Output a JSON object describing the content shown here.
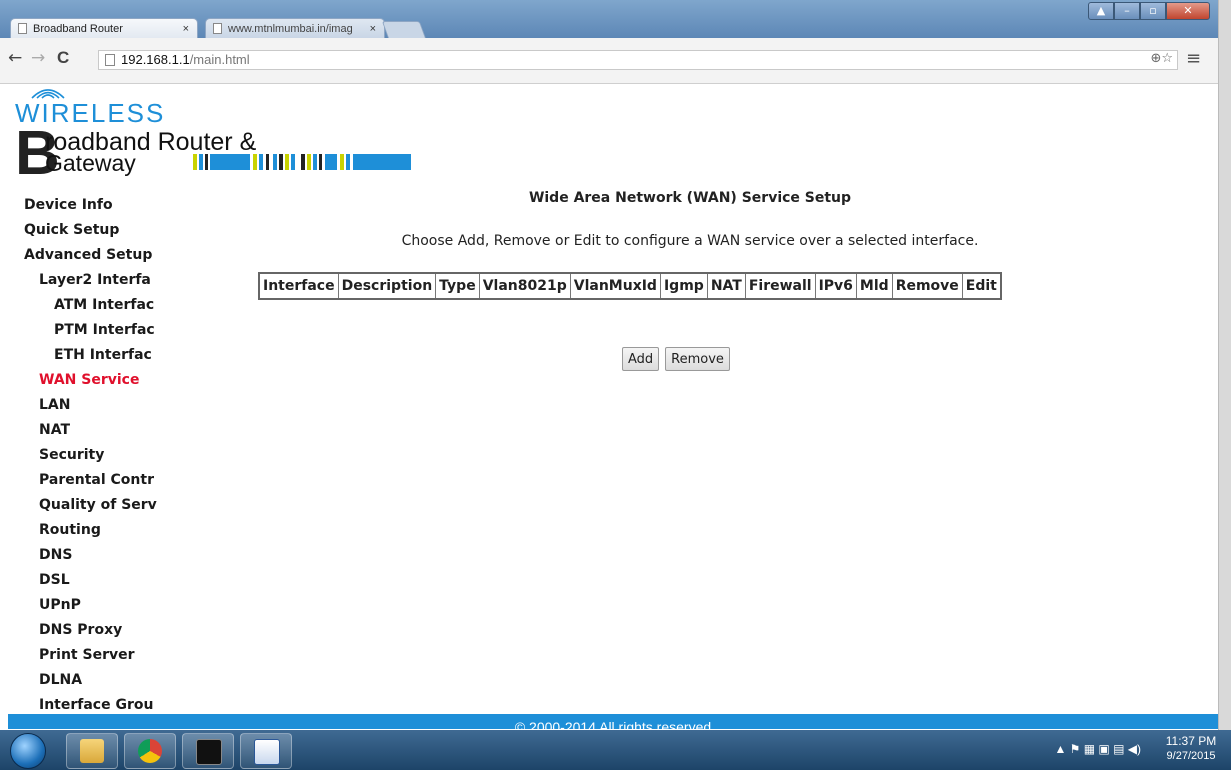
{
  "browser": {
    "tabs": [
      {
        "label": "Broadband Router",
        "close": "×"
      },
      {
        "label": "www.mtnlmumbai.in/imag",
        "close": "×"
      }
    ],
    "url_host": "192.168.1.1",
    "url_path": "/main.html",
    "back": "←",
    "forward": "→",
    "reload": "C",
    "url_right": "⊕☆",
    "menu": "≡"
  },
  "logo": {
    "wireless": "WIRELESS",
    "letter_b": "B",
    "line1": "roadband Router &",
    "line2": "Gateway"
  },
  "sidebar": {
    "items": [
      {
        "label": "Device Info",
        "level": 1
      },
      {
        "label": "Quick Setup",
        "level": 1
      },
      {
        "label": "Advanced Setup",
        "level": 1
      },
      {
        "label": "Layer2 Interfa",
        "level": 2
      },
      {
        "label": "ATM Interfac",
        "level": 3
      },
      {
        "label": "PTM Interfac",
        "level": 3
      },
      {
        "label": "ETH Interfac",
        "level": 3
      },
      {
        "label": "WAN Service",
        "level": 2,
        "active": true
      },
      {
        "label": "LAN",
        "level": 2
      },
      {
        "label": "NAT",
        "level": 2
      },
      {
        "label": "Security",
        "level": 2
      },
      {
        "label": "Parental Contr",
        "level": 2
      },
      {
        "label": "Quality of Serv",
        "level": 2
      },
      {
        "label": "Routing",
        "level": 2
      },
      {
        "label": "DNS",
        "level": 2
      },
      {
        "label": "DSL",
        "level": 2
      },
      {
        "label": "UPnP",
        "level": 2
      },
      {
        "label": "DNS Proxy",
        "level": 2
      },
      {
        "label": "Print Server",
        "level": 2
      },
      {
        "label": "DLNA",
        "level": 2
      },
      {
        "label": "Interface Grou",
        "level": 2
      }
    ]
  },
  "main": {
    "title": "Wide Area Network (WAN) Service Setup",
    "instruction": "Choose Add, Remove or Edit to configure a WAN service over a selected interface.",
    "table_headers": [
      "Interface",
      "Description",
      "Type",
      "Vlan8021p",
      "VlanMuxId",
      "Igmp",
      "NAT",
      "Firewall",
      "IPv6",
      "Mld",
      "Remove",
      "Edit"
    ],
    "add_label": "Add",
    "remove_label": "Remove"
  },
  "footer": {
    "text": "© 2000-2014  All rights reserved"
  },
  "taskbar": {
    "time": "11:37 PM",
    "date": "9/27/2015",
    "tray_icons": "▲  ⚑  ▦  ▣  ▤  ◀)"
  },
  "colors": {
    "accent_blue": "#1e8fd8",
    "active_red": "#e0102c"
  }
}
